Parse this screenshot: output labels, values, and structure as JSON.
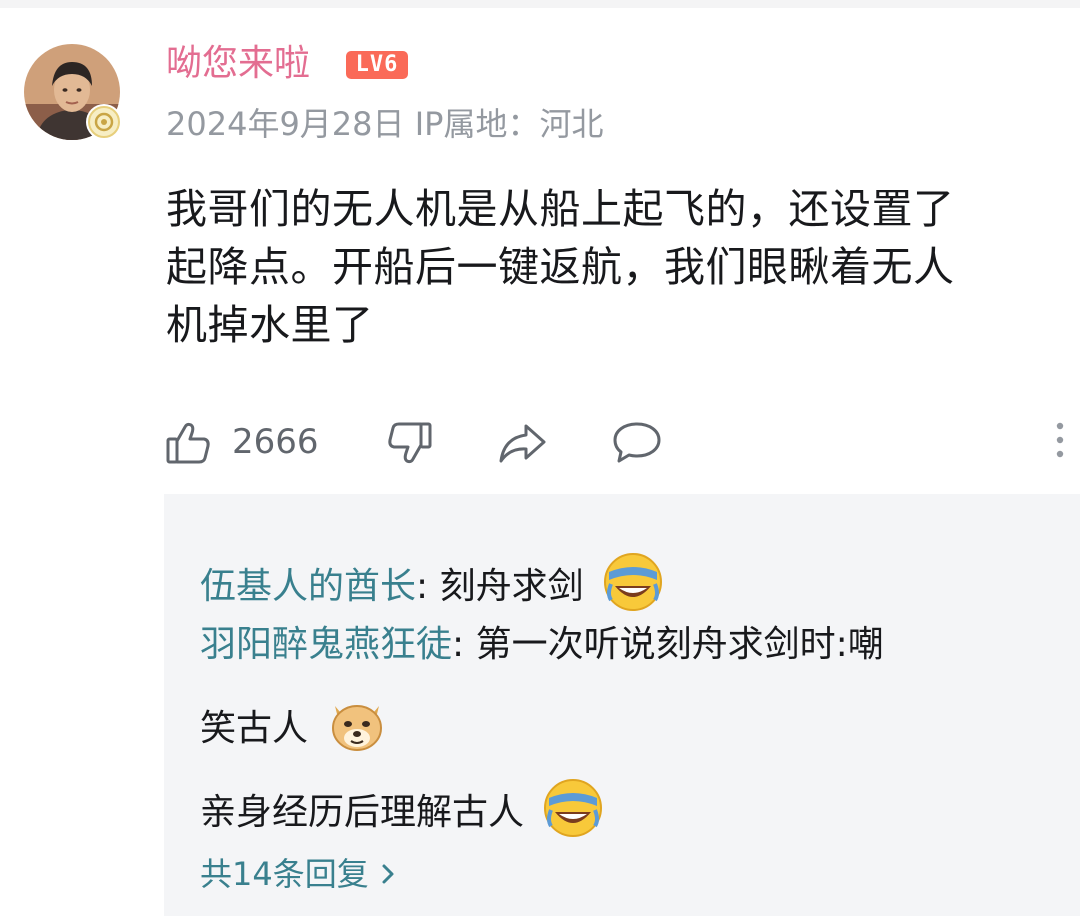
{
  "comment": {
    "username": "呦您来啦",
    "level_badge": "LV6",
    "date": "2024年9月28日",
    "ip_location": "IP属地：河北",
    "text_lines": [
      "我哥们的无人机是从船上起飞的，还设置了",
      "起降点。开船后一键返航，我们眼瞅着无人",
      "机掉水里了"
    ],
    "like_count": "2666",
    "icons": [
      "thumbs-up-icon",
      "thumbs-down-icon",
      "share-icon",
      "comment-icon",
      "more-icon"
    ]
  },
  "replies": {
    "items": [
      {
        "user": "伍基人的酋长",
        "text": ": 刻舟求剑",
        "emoji": "crying-laughing-emoji"
      },
      {
        "user": "羽阳醉鬼燕狂徒",
        "text": ": 第一次听说刻舟求剑时:嘲",
        "emoji": null
      },
      {
        "user": "",
        "text": "笑古人",
        "emoji": "doge-emoji"
      },
      {
        "user": "",
        "text": "亲身经历后理解古人",
        "emoji": "crying-laughing-emoji"
      }
    ],
    "more_text": "共14条回复"
  },
  "colors": {
    "username": "#e36d91",
    "level_badge": "#fa6a58",
    "reply_user": "#39808e",
    "reply_bg": "#f4f5f7",
    "meta": "#9499a0"
  }
}
